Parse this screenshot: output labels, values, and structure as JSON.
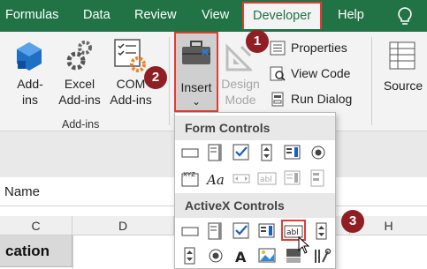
{
  "tabs": [
    {
      "id": "formulas",
      "label": "Formulas"
    },
    {
      "id": "data",
      "label": "Data"
    },
    {
      "id": "review",
      "label": "Review"
    },
    {
      "id": "view",
      "label": "View"
    },
    {
      "id": "developer",
      "label": "Developer"
    },
    {
      "id": "help",
      "label": "Help"
    }
  ],
  "ribbon": {
    "addins_group": {
      "label": "Add-ins",
      "addins_label": "Add-\nins",
      "excel_addins_label": "Excel\nAdd-ins",
      "com_addins_label": "COM\nAdd-ins"
    },
    "controls_group": {
      "insert_label": "Insert",
      "insert_chevron": "⌄",
      "design_mode_label": "Design\nMode",
      "properties_label": "Properties",
      "view_code_label": "View Code",
      "run_dialog_label": "Run Dialog"
    },
    "source_label": "Source"
  },
  "name_box": {
    "label": "Name"
  },
  "columns": [
    "C",
    "D",
    "H"
  ],
  "cell_text": "cation",
  "dropdown": {
    "form_controls_header": "Form Controls",
    "activex_controls_header": "ActiveX Controls"
  },
  "steps": [
    "1",
    "2",
    "3"
  ],
  "colors": {
    "excel_green": "#217346",
    "highlight_red": "#e23c32",
    "step_badge": "#8f1f25"
  }
}
